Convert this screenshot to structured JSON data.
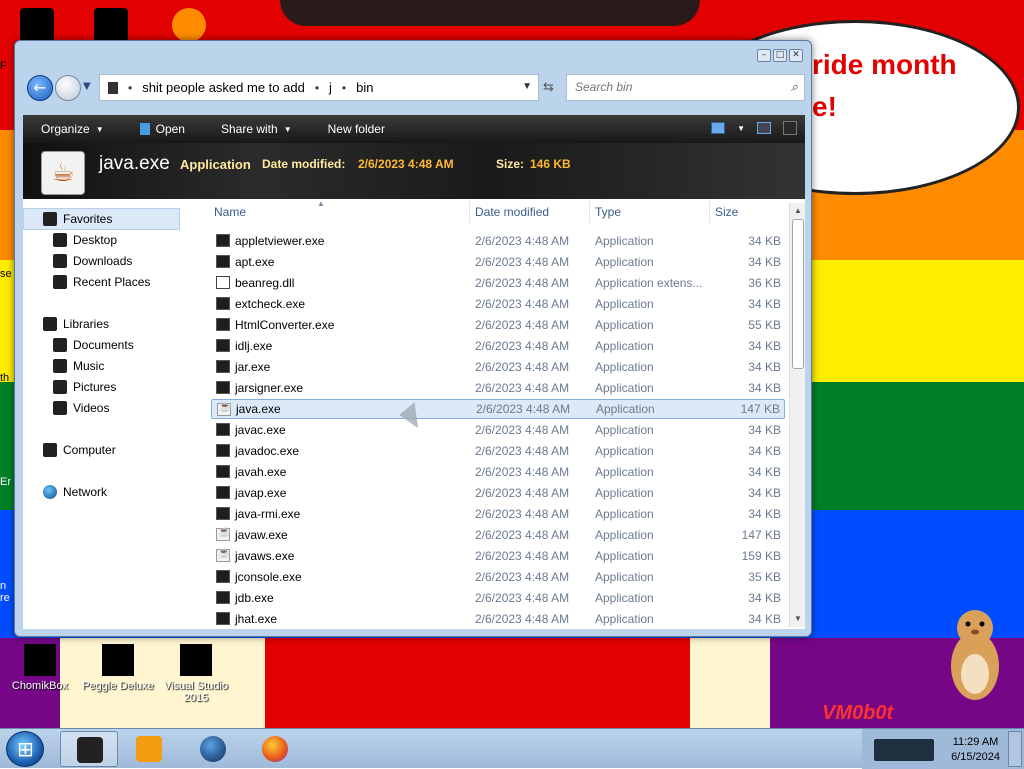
{
  "desktop": {
    "speech_text_1": "ride month",
    "speech_text_2": "e!",
    "watermark": "VM0b0t",
    "left_clip_1": "F",
    "left_clip_2": "se",
    "left_clip_3": "th",
    "left_clip_4": "Er",
    "left_clip_5": "n re",
    "icons": [
      {
        "label": "ChomikBox"
      },
      {
        "label": "Peggle Deluxe"
      },
      {
        "label": "Visual Studio 2015"
      }
    ]
  },
  "window": {
    "breadcrumb": [
      "shit people asked me to add",
      "j",
      "bin"
    ],
    "search_placeholder": "Search bin",
    "toolbar": {
      "organize": "Organize",
      "open": "Open",
      "share_with": "Share with",
      "new_folder": "New folder"
    },
    "details": {
      "name": "java.exe",
      "type": "Application",
      "date_label": "Date modified:",
      "date_value": "2/6/2023 4:48 AM",
      "size_label": "Size:",
      "size_value": "146 KB"
    },
    "nav": {
      "favorites": "Favorites",
      "desktop": "Desktop",
      "downloads": "Downloads",
      "recent_places": "Recent Places",
      "libraries": "Libraries",
      "documents": "Documents",
      "music": "Music",
      "pictures": "Pictures",
      "videos": "Videos",
      "computer": "Computer",
      "network": "Network"
    },
    "columns": {
      "name": "Name",
      "date": "Date modified",
      "type": "Type",
      "size": "Size"
    },
    "files": [
      {
        "name": "appletviewer.exe",
        "date": "2/6/2023 4:48 AM",
        "type": "Application",
        "size": "34 KB",
        "icon": "exe"
      },
      {
        "name": "apt.exe",
        "date": "2/6/2023 4:48 AM",
        "type": "Application",
        "size": "34 KB",
        "icon": "exe"
      },
      {
        "name": "beanreg.dll",
        "date": "2/6/2023 4:48 AM",
        "type": "Application extens...",
        "size": "36 KB",
        "icon": "dll"
      },
      {
        "name": "extcheck.exe",
        "date": "2/6/2023 4:48 AM",
        "type": "Application",
        "size": "34 KB",
        "icon": "exe"
      },
      {
        "name": "HtmlConverter.exe",
        "date": "2/6/2023 4:48 AM",
        "type": "Application",
        "size": "55 KB",
        "icon": "exe"
      },
      {
        "name": "idlj.exe",
        "date": "2/6/2023 4:48 AM",
        "type": "Application",
        "size": "34 KB",
        "icon": "exe"
      },
      {
        "name": "jar.exe",
        "date": "2/6/2023 4:48 AM",
        "type": "Application",
        "size": "34 KB",
        "icon": "exe"
      },
      {
        "name": "jarsigner.exe",
        "date": "2/6/2023 4:48 AM",
        "type": "Application",
        "size": "34 KB",
        "icon": "exe"
      },
      {
        "name": "java.exe",
        "date": "2/6/2023 4:48 AM",
        "type": "Application",
        "size": "147 KB",
        "icon": "java"
      },
      {
        "name": "javac.exe",
        "date": "2/6/2023 4:48 AM",
        "type": "Application",
        "size": "34 KB",
        "icon": "exe"
      },
      {
        "name": "javadoc.exe",
        "date": "2/6/2023 4:48 AM",
        "type": "Application",
        "size": "34 KB",
        "icon": "exe"
      },
      {
        "name": "javah.exe",
        "date": "2/6/2023 4:48 AM",
        "type": "Application",
        "size": "34 KB",
        "icon": "exe"
      },
      {
        "name": "javap.exe",
        "date": "2/6/2023 4:48 AM",
        "type": "Application",
        "size": "34 KB",
        "icon": "exe"
      },
      {
        "name": "java-rmi.exe",
        "date": "2/6/2023 4:48 AM",
        "type": "Application",
        "size": "34 KB",
        "icon": "exe"
      },
      {
        "name": "javaw.exe",
        "date": "2/6/2023 4:48 AM",
        "type": "Application",
        "size": "147 KB",
        "icon": "java"
      },
      {
        "name": "javaws.exe",
        "date": "2/6/2023 4:48 AM",
        "type": "Application",
        "size": "159 KB",
        "icon": "java"
      },
      {
        "name": "jconsole.exe",
        "date": "2/6/2023 4:48 AM",
        "type": "Application",
        "size": "35 KB",
        "icon": "exe"
      },
      {
        "name": "jdb.exe",
        "date": "2/6/2023 4:48 AM",
        "type": "Application",
        "size": "34 KB",
        "icon": "exe"
      },
      {
        "name": "jhat.exe",
        "date": "2/6/2023 4:48 AM",
        "type": "Application",
        "size": "34 KB",
        "icon": "exe"
      }
    ],
    "selected_file": "java.exe"
  },
  "taskbar": {
    "time": "11:29 AM",
    "date": "6/15/2024",
    "pinned": [
      "explorer-icon",
      "media-player-icon",
      "browser-globe-icon",
      "firefox-icon"
    ]
  },
  "colors": {
    "accent": "#1a5fc0",
    "selection": "#dce9f8",
    "details_highlight": "#ffb830"
  }
}
